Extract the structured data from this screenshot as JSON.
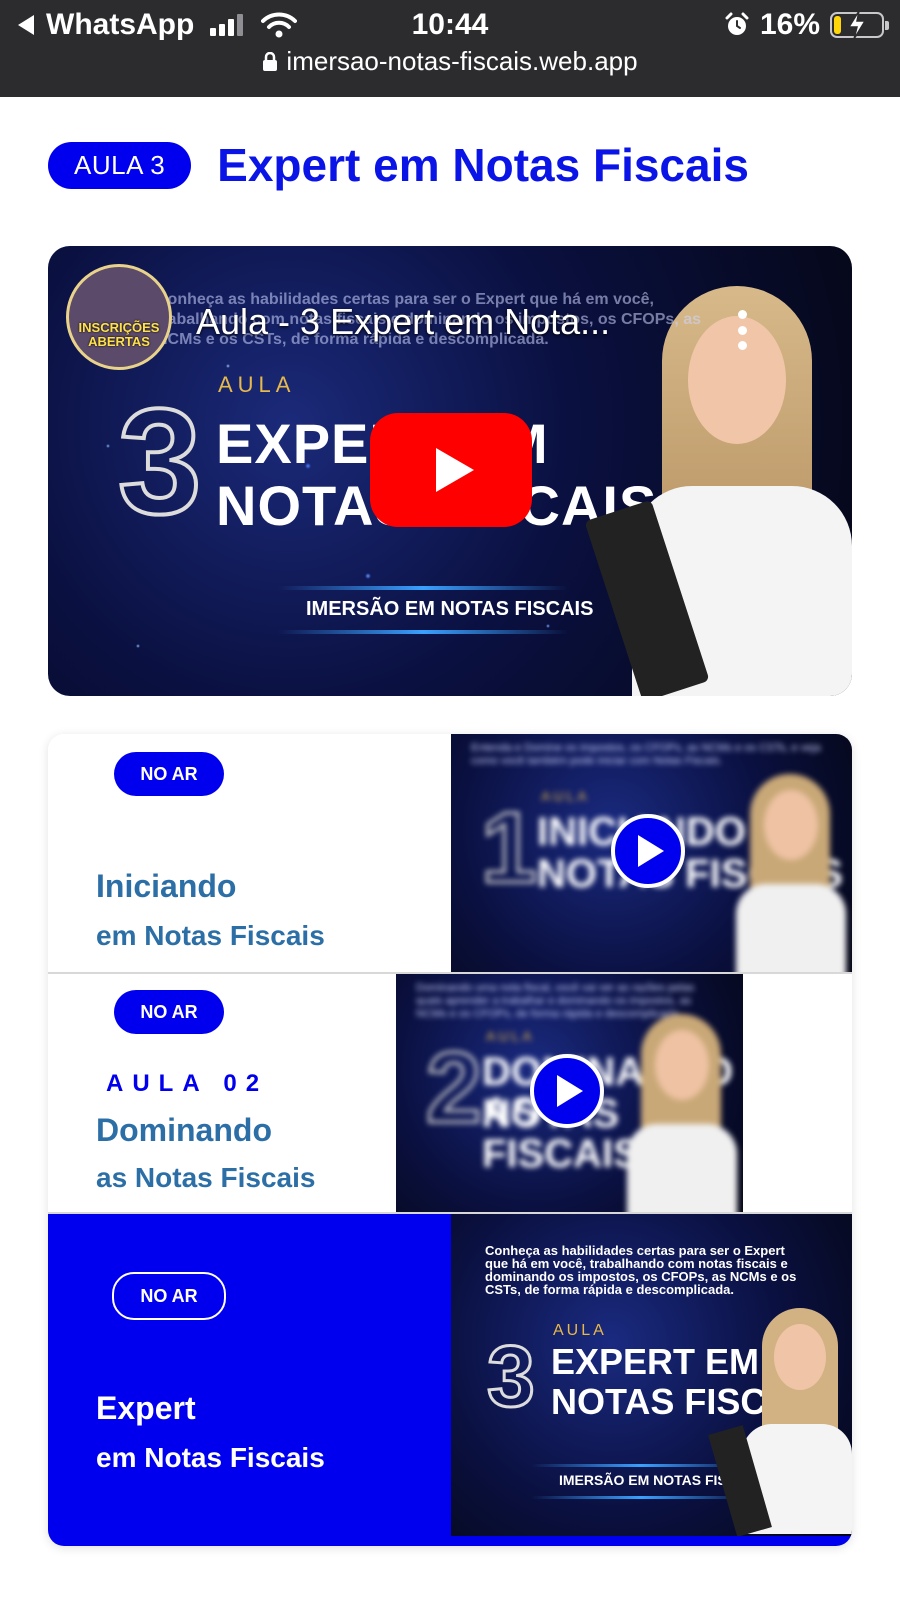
{
  "status_bar": {
    "back_app": "WhatsApp",
    "time": "10:44",
    "battery_percent": "16%",
    "battery_level": 0.16,
    "url": "imersao-notas-fiscais.web.app"
  },
  "header": {
    "lesson_pill": "AULA 3",
    "title": "Expert em Notas Fiscais"
  },
  "video": {
    "title": "Aula - 3 Expert em Nota...",
    "description": "Conheça as habilidades certas para ser o Expert que há em você, trabalhando com notas fiscais e dominando os impostos, os CFOPs, as NCMs e os CSTs, de forma rápida e descomplicada.",
    "channel_badge": "INSCRIÇÕES ABERTAS",
    "thumb_aula": "AULA",
    "thumb_number": "3",
    "thumb_line1": "EXPERT EM",
    "thumb_line2": "NOTAS FISCAIS",
    "thumb_subtitle": "IMERSÃO EM NOTAS FISCAIS"
  },
  "lessons": [
    {
      "badge": "NO AR",
      "kicker": "",
      "title": "Iniciando",
      "subtitle": "em Notas Fiscais",
      "thumb": {
        "aula": "AULA",
        "number": "1",
        "line1": "INICIANDO EM",
        "line2": "NOTAS FISCAIS",
        "text": "Entenda e Domine os impostos, os CFOPs, as NCMs e os CSTs, e veja como você também pode iniciar com Notas Fiscais."
      }
    },
    {
      "badge": "NO AR",
      "kicker": "AULA 02",
      "title": "Dominando",
      "subtitle": "as Notas Fiscais",
      "thumb": {
        "aula": "AULA",
        "number": "2",
        "line1": "DOMINANDO AS",
        "line2": "NOTAS FISCAIS",
        "text": "Dominando uma nota fiscal, você vai ver as razões pelas quais aprender a trabalhar e dominando os impostos, as NCMs e os CFOPs, de forma rápida e descomplicada."
      }
    },
    {
      "badge": "NO AR",
      "kicker": "",
      "title": "Expert",
      "subtitle": "em Notas Fiscais",
      "thumb": {
        "aula": "AULA",
        "number": "3",
        "line1": "EXPERT EM",
        "line2": "NOTAS FISCAIS",
        "subtitle": "IMERSÃO EM NOTAS FISCAIS",
        "text": "Conheça as habilidades certas para ser o Expert que há em você, trabalhando com notas fiscais e dominando os impostos, os CFOPs, as NCMs e os CSTs, de forma rápida e descomplicada."
      }
    }
  ],
  "colors": {
    "accent_blue": "#0000ee",
    "title_blue": "#0a14e6",
    "lesson_text_blue": "#2c6ea6",
    "youtube_red": "#ff0000",
    "status_bar_bg": "#2c2c2e"
  },
  "icons": [
    "back-arrow-icon",
    "cellular-signal-icon",
    "wifi-icon",
    "alarm-icon",
    "battery-charging-icon",
    "lock-icon",
    "youtube-play-icon",
    "more-options-icon",
    "play-circle-icon"
  ]
}
